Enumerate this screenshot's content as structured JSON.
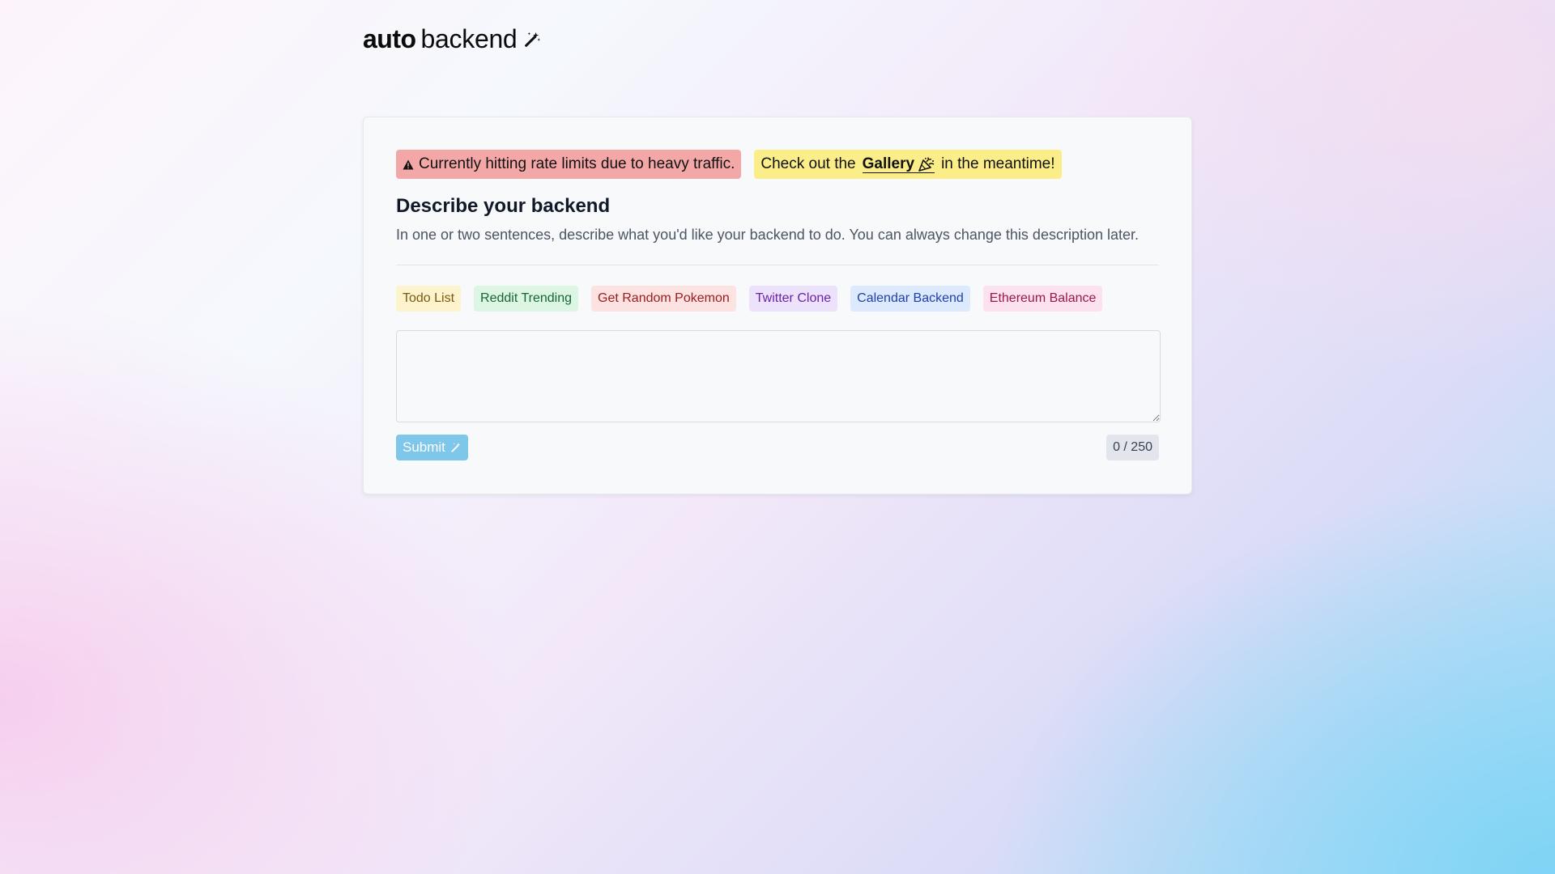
{
  "logo": {
    "bold": "auto",
    "regular": "backend",
    "icon": "magic-wand-icon"
  },
  "alerts": {
    "rate_limit": {
      "icon": "warning-icon",
      "text": "Currently hitting rate limits due to heavy traffic.",
      "color": "#f4a7a7"
    },
    "gallery": {
      "prefix": "Check out the",
      "link": "Gallery",
      "icon": "party-popper-icon",
      "suffix": "in the meantime!",
      "color": "#fbed87"
    }
  },
  "form": {
    "title": "Describe your backend",
    "subtitle": "In one or two sentences, describe what you'd like your backend to do. You can always change this description later.",
    "examples": [
      "Todo List",
      "Reddit Trending",
      "Get Random Pokemon",
      "Twitter Clone",
      "Calendar Backend",
      "Ethereum Balance"
    ],
    "description_value": "",
    "submit_label": "Submit",
    "submit_icon": "magic-wand-icon",
    "counter": "0 / 250"
  },
  "colors": {
    "submit": "#7ec6ea",
    "card": "#f8f9fb"
  }
}
